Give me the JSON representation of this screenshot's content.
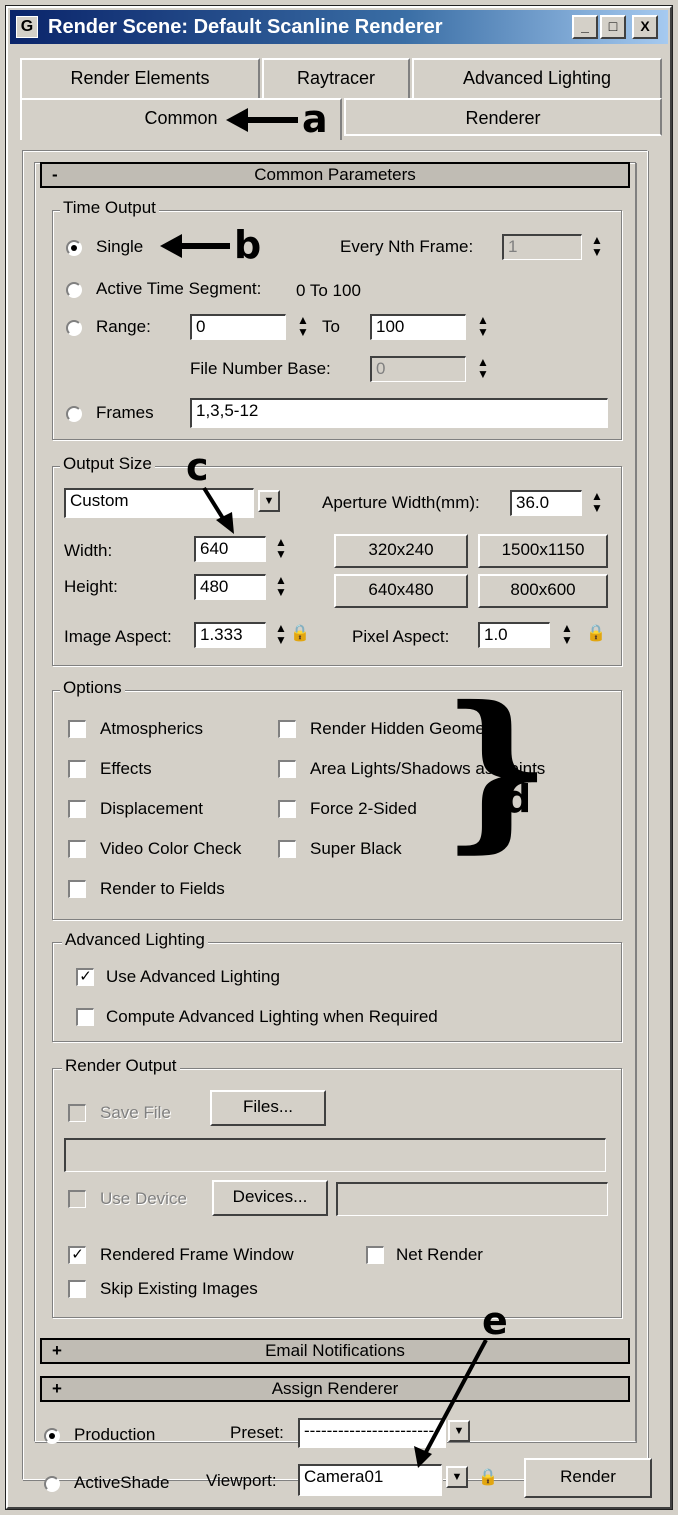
{
  "window": {
    "title": "Render Scene: Default Scanline Renderer",
    "buttons": {
      "minimize": "_",
      "maximize": "□",
      "close": "X"
    }
  },
  "tabs": {
    "row1": [
      "Render Elements",
      "Raytracer",
      "Advanced Lighting"
    ],
    "row2": [
      "Common",
      "Renderer"
    ],
    "active": "Common"
  },
  "common_parameters": {
    "header": "Common Parameters",
    "collapse_sign": "-",
    "time_output": {
      "title": "Time Output",
      "single": "Single",
      "single_selected": true,
      "every_nth_label": "Every Nth Frame:",
      "every_nth_value": "1",
      "active_segment_label": "Active Time Segment:",
      "active_segment_value": "0 To 100",
      "range_label": "Range:",
      "range_from": "0",
      "range_to_label": "To",
      "range_to": "100",
      "file_number_base_label": "File Number Base:",
      "file_number_base_value": "0",
      "frames_label": "Frames",
      "frames_value": "1,3,5-12"
    },
    "output_size": {
      "title": "Output Size",
      "preset": "Custom",
      "aperture_label": "Aperture Width(mm):",
      "aperture_value": "36.0",
      "width_label": "Width:",
      "width_value": "640",
      "height_label": "Height:",
      "height_value": "480",
      "presets": [
        "320x240",
        "1500x1150",
        "640x480",
        "800x600"
      ],
      "image_aspect_label": "Image Aspect:",
      "image_aspect_value": "1.333",
      "pixel_aspect_label": "Pixel Aspect:",
      "pixel_aspect_value": "1.0"
    },
    "options": {
      "title": "Options",
      "left": [
        "Atmospherics",
        "Effects",
        "Displacement",
        "Video Color Check",
        "Render to Fields"
      ],
      "right": [
        "Render Hidden Geometry",
        "Area Lights/Shadows as Points",
        "Force 2-Sided",
        "Super Black"
      ]
    },
    "advanced_lighting": {
      "title": "Advanced Lighting",
      "use": "Use Advanced Lighting",
      "use_checked": true,
      "compute": "Compute Advanced Lighting when Required",
      "compute_checked": false
    },
    "render_output": {
      "title": "Render Output",
      "save_file": "Save File",
      "files_button": "Files...",
      "use_device": "Use Device",
      "devices_button": "Devices...",
      "rendered_frame_window": "Rendered Frame Window",
      "rendered_frame_window_checked": true,
      "net_render": "Net Render",
      "skip_existing": "Skip Existing Images"
    }
  },
  "collapsed_rollouts": [
    {
      "sign": "+",
      "label": "Email Notifications"
    },
    {
      "sign": "+",
      "label": "Assign Renderer"
    }
  ],
  "bottom": {
    "production": "Production",
    "activeshade": "ActiveShade",
    "preset_label": "Preset:",
    "preset_value": "------------------------",
    "viewport_label": "Viewport:",
    "viewport_value": "Camera01",
    "render_button": "Render"
  },
  "annotations": [
    "a",
    "b",
    "c",
    "d",
    "e"
  ],
  "icons": [
    "app-icon",
    "lock-icon",
    "spinner-icon",
    "dropdown-arrow-icon",
    "arrow-annotation-icon"
  ]
}
